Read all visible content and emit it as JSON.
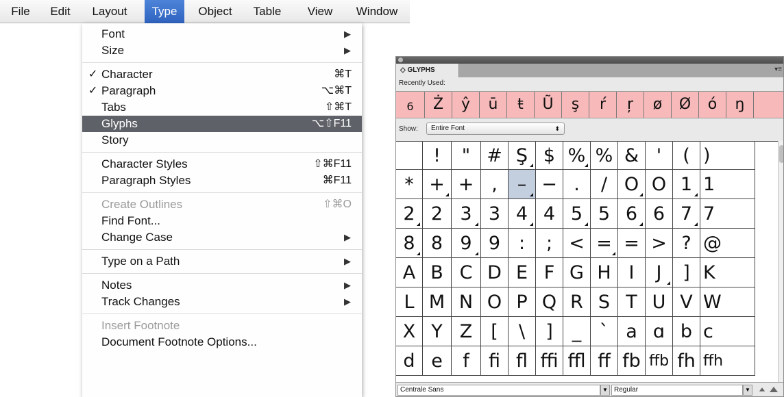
{
  "menubar": {
    "items": [
      "File",
      "Edit",
      "Layout",
      "Type",
      "Object",
      "Table",
      "View",
      "Window"
    ]
  },
  "type_menu": {
    "groups": [
      [
        {
          "label": "Font",
          "submenu": true
        },
        {
          "label": "Size",
          "submenu": true
        }
      ],
      [
        {
          "label": "Character",
          "check": "✓",
          "shortcut": "⌘T"
        },
        {
          "label": "Paragraph",
          "check": "✓",
          "shortcut": "⌥⌘T"
        },
        {
          "label": "Tabs",
          "shortcut": "⇧⌘T"
        },
        {
          "label": "Glyphs",
          "shortcut": "⌥⇧F11",
          "highlighted": true
        },
        {
          "label": "Story"
        }
      ],
      [
        {
          "label": "Character Styles",
          "shortcut": "⇧⌘F11"
        },
        {
          "label": "Paragraph Styles",
          "shortcut": "⌘F11"
        }
      ],
      [
        {
          "label": "Create Outlines",
          "shortcut": "⇧⌘O",
          "disabled": true
        },
        {
          "label": "Find Font..."
        },
        {
          "label": "Change Case",
          "submenu": true
        }
      ],
      [
        {
          "label": "Type on a Path",
          "submenu": true
        }
      ],
      [
        {
          "label": "Notes",
          "submenu": true
        },
        {
          "label": "Track Changes",
          "submenu": true
        }
      ],
      [
        {
          "label": "Insert Footnote",
          "disabled": true
        },
        {
          "label": "Document Footnote Options..."
        }
      ]
    ]
  },
  "glyphs_panel": {
    "tab_label": "◇ GLYPHS",
    "menu_icon": "panel-menu-icon",
    "recently_used_label": "Recently Used:",
    "recent_glyphs": [
      "6",
      "Ż",
      "ŷ",
      "ū",
      "ŧ",
      "Ũ",
      "ş",
      "ŕ",
      "ŗ",
      "ø",
      "Ø",
      "ó",
      "ŋ"
    ],
    "show_label": "Show:",
    "show_value": "Entire Font",
    "grid": [
      [
        " ",
        "!",
        "\"",
        "#",
        "Ş",
        "$",
        "%",
        "%",
        "&",
        "'",
        "(",
        ")"
      ],
      [
        "*",
        "+",
        "+",
        ",",
        "–",
        "−",
        ".",
        "/",
        "O",
        "O",
        "1",
        "1"
      ],
      [
        "2",
        "2",
        "3",
        "3",
        "4",
        "4",
        "5",
        "5",
        "6",
        "6",
        "7",
        "7"
      ],
      [
        "8",
        "8",
        "9",
        "9",
        ":",
        ";",
        "<",
        "=",
        "=",
        ">",
        "?",
        "@"
      ],
      [
        "A",
        "B",
        "C",
        "D",
        "E",
        "F",
        "G",
        "H",
        "I",
        "J",
        "]",
        "K"
      ],
      [
        "L",
        "M",
        "N",
        "O",
        "P",
        "Q",
        "R",
        "S",
        "T",
        "U",
        "V",
        "W"
      ],
      [
        "X",
        "Y",
        "Z",
        "[",
        "\\",
        "]",
        "_",
        "`",
        "a",
        "ɑ",
        "b",
        "c"
      ],
      [
        "d",
        "e",
        "f",
        "ﬁ",
        "ﬂ",
        "ﬃ",
        "ﬄ",
        "ﬀ",
        "fb",
        "ffb",
        "fh",
        "ffh"
      ]
    ],
    "alternates": [
      [
        0,
        4
      ],
      [
        0,
        6
      ],
      [
        1,
        1
      ],
      [
        1,
        4
      ],
      [
        1,
        8
      ],
      [
        1,
        10
      ],
      [
        2,
        0
      ],
      [
        2,
        2
      ],
      [
        2,
        4
      ],
      [
        2,
        6
      ],
      [
        2,
        8
      ],
      [
        2,
        10
      ],
      [
        3,
        0
      ],
      [
        3,
        2
      ],
      [
        3,
        7
      ],
      [
        4,
        9
      ]
    ],
    "selected": [
      1,
      4
    ],
    "font_family": "Centrale Sans",
    "font_style": "Regular",
    "dropdown_icon": "triangle-down",
    "zoom_out_icon": "small-mountain-icon",
    "zoom_in_icon": "large-mountain-icon"
  }
}
